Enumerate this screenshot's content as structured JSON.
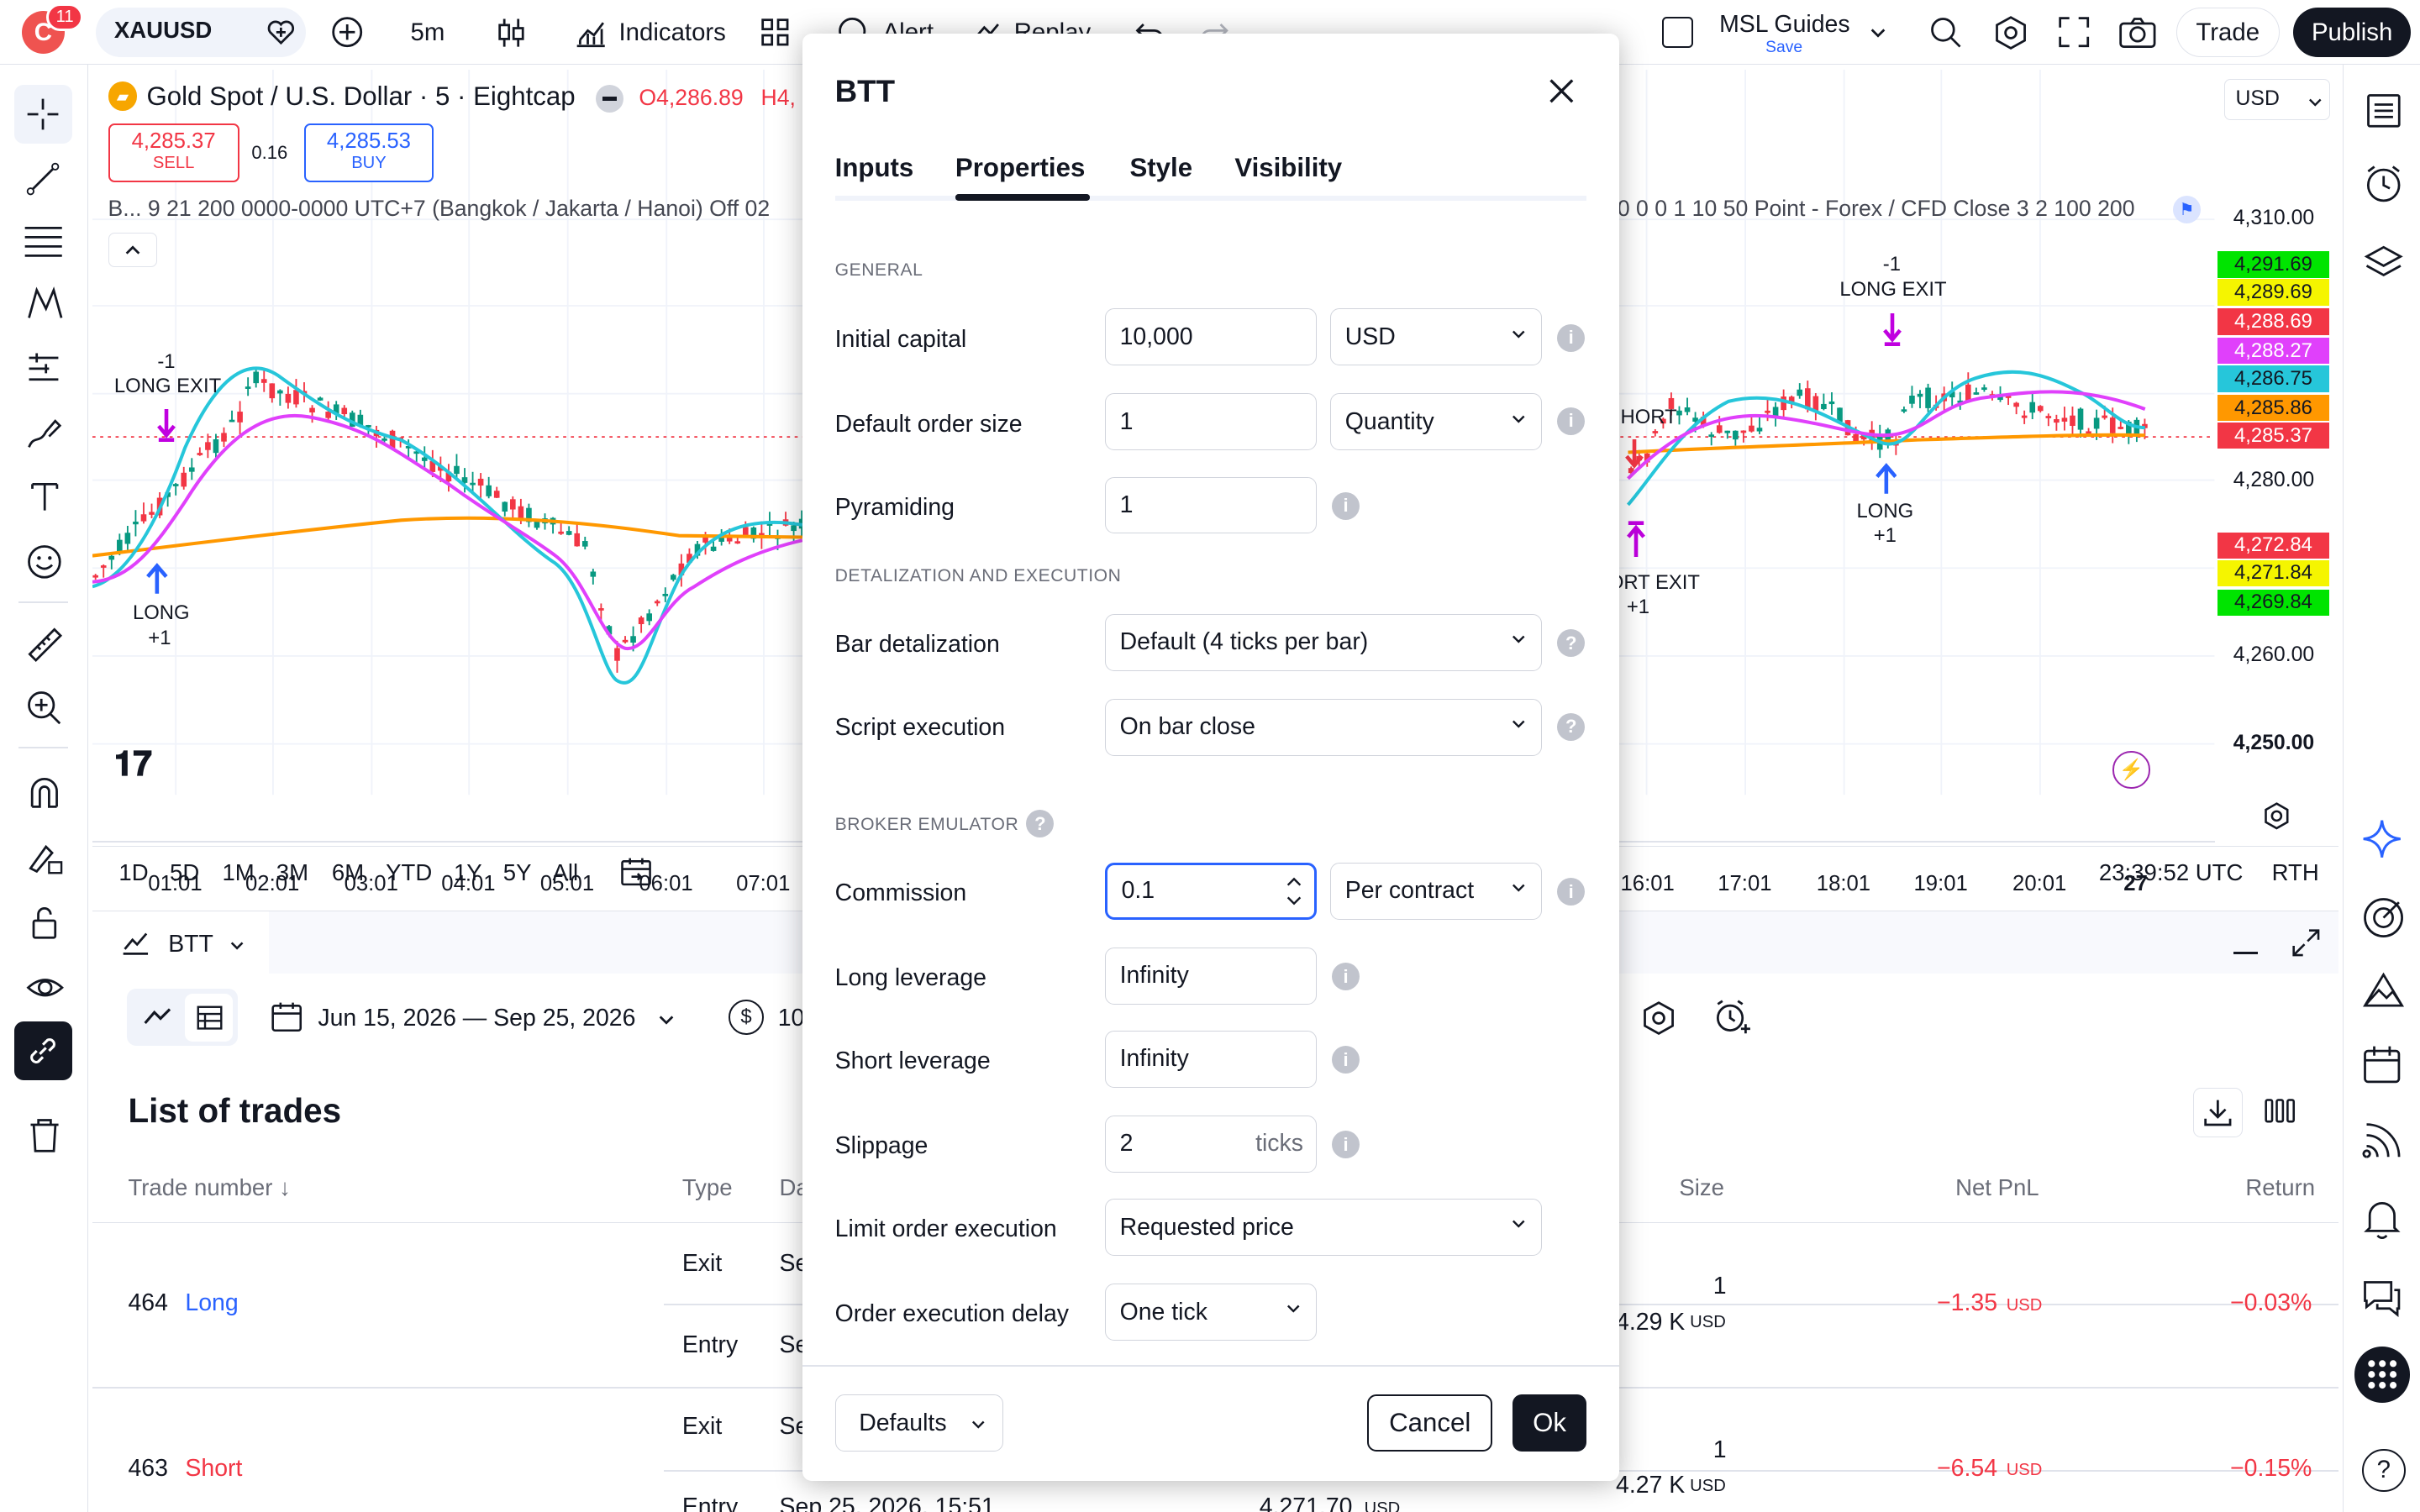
{
  "topbar": {
    "notif_count": "11",
    "symbol": "XAUUSD",
    "interval": "5m",
    "indicators": "Indicators",
    "alert": "Alert",
    "replay": "Replay",
    "layout_name": "MSL Guides",
    "layout_save": "Save",
    "trade": "Trade",
    "publish": "Publish"
  },
  "chart": {
    "title": "Gold Spot / U.S. Dollar · 5 · Eightcap",
    "ohlc_o": "O4,286.89",
    "ohlc_h": "H4,",
    "sell_price": "4,285.37",
    "sell_label": "SELL",
    "spread": "0.16",
    "buy_price": "4,285.53",
    "buy_label": "BUY",
    "strategy_params_left": "B... 9 21 200 0000-0000 UTC+7 (Bangkok / Jakarta / Hanoi) Off 02",
    "strategy_params_right": "0 0 0 1 10 50 Point - Forex / CFD Close 3 2 100 200",
    "currency": "USD",
    "price_axis": [
      "4,310.00",
      "4,280.00",
      "4,260.00",
      "4,250.00"
    ],
    "price_badges": [
      {
        "text": "4,291.69",
        "bg": "#00e400",
        "fg": "#131722"
      },
      {
        "text": "4,289.69",
        "bg": "#f5f500",
        "fg": "#131722"
      },
      {
        "text": "4,288.69",
        "bg": "#f23645",
        "fg": "#ffffff"
      },
      {
        "text": "4,288.27",
        "bg": "#e040fb",
        "fg": "#ffffff"
      },
      {
        "text": "4,286.75",
        "bg": "#26c6da",
        "fg": "#131722"
      },
      {
        "text": "4,285.86",
        "bg": "#ff9800",
        "fg": "#131722"
      },
      {
        "text": "4,285.37",
        "bg": "#f23645",
        "fg": "#ffffff"
      },
      {
        "text": "4,272.84",
        "bg": "#f23645",
        "fg": "#ffffff"
      },
      {
        "text": "4,271.84",
        "bg": "#f5f500",
        "fg": "#131722"
      },
      {
        "text": "4,269.84",
        "bg": "#00e400",
        "fg": "#131722"
      }
    ],
    "time_axis": [
      "01:01",
      "02:01",
      "03:01",
      "04:01",
      "05:01",
      "06:01",
      "07:01",
      "16:01",
      "17:01",
      "18:01",
      "19:01",
      "20:01",
      "27"
    ],
    "markers": {
      "long_exit_left_qty": "-1",
      "long_exit_left": "LONG EXIT",
      "long_left": "LONG",
      "long_left_qty": "+1",
      "long_exit_right_qty": "-1",
      "long_exit_right": "LONG EXIT",
      "short_right": "HORT",
      "long_right": "LONG",
      "long_right_qty": "+1",
      "short_exit_right": "ORT EXIT",
      "short_exit_right_qty": "+1"
    },
    "ranges": [
      "1D",
      "5D",
      "1M",
      "3M",
      "6M",
      "YTD",
      "1Y",
      "5Y",
      "All"
    ],
    "clock": "23:39:52 UTC",
    "session": "RTH"
  },
  "panel": {
    "tab": "BTT",
    "date_range": "Jun 15, 2026 — Sep 25, 2026",
    "capital_partial": "10",
    "list_title": "List of trades",
    "columns": {
      "trade_number": "Trade number ↓",
      "type": "Type",
      "date": "Da",
      "size": "Size",
      "net_pnl": "Net PnL",
      "return": "Return"
    },
    "trades": [
      {
        "number": "464",
        "side": "Long",
        "exit": "Exit",
        "entry": "Entry",
        "date_exit": "Se",
        "date_entry": "Se",
        "size_qty": "1",
        "size_val": "4.29 K",
        "size_unit": "USD",
        "pnl": "−1.35",
        "pnl_unit": "USD",
        "ret": "−0.03%"
      },
      {
        "number": "463",
        "side": "Short",
        "exit": "Exit",
        "entry": "Entry",
        "date_exit": "Se",
        "date_entry": "Sep 25, 2026, 15:51",
        "price_entry": "4,271.70",
        "price_unit": "USD",
        "size_qty": "1",
        "size_val": "4.27 K",
        "size_unit": "USD",
        "pnl": "−6.54",
        "pnl_unit": "USD",
        "ret": "−0.15%"
      }
    ]
  },
  "modal": {
    "title": "BTT",
    "tabs": [
      "Inputs",
      "Properties",
      "Style",
      "Visibility"
    ],
    "section_general": "GENERAL",
    "initial_capital_label": "Initial capital",
    "initial_capital": "10,000",
    "capital_currency": "USD",
    "order_size_label": "Default order size",
    "order_size": "1",
    "order_size_type": "Quantity",
    "pyramiding_label": "Pyramiding",
    "pyramiding": "1",
    "section_detail": "DETALIZATION AND EXECUTION",
    "bar_detail_label": "Bar detalization",
    "bar_detail": "Default (4 ticks per bar)",
    "script_exec_label": "Script execution",
    "script_exec": "On bar close",
    "section_broker": "BROKER EMULATOR",
    "commission_label": "Commission",
    "commission": "0.1",
    "commission_type": "Per contract",
    "long_lev_label": "Long leverage",
    "long_lev": "Infinity",
    "short_lev_label": "Short leverage",
    "short_lev": "Infinity",
    "slippage_label": "Slippage",
    "slippage": "2",
    "slippage_unit": "ticks",
    "limit_exec_label": "Limit order execution",
    "limit_exec": "Requested price",
    "delay_label": "Order execution delay",
    "delay": "One tick",
    "defaults_btn": "Defaults",
    "cancel_btn": "Cancel",
    "ok_btn": "Ok",
    "info_glyph": "i",
    "help_glyph": "?"
  }
}
